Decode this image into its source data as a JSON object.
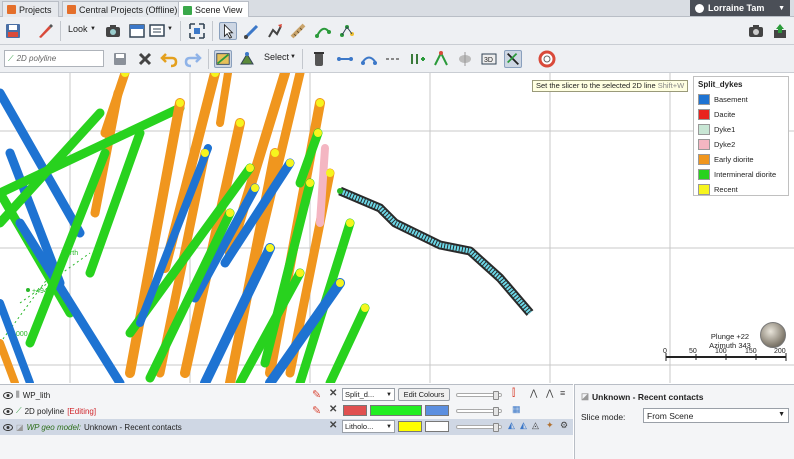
{
  "tabs": [
    {
      "label": "Projects",
      "icon": "projects-icon"
    },
    {
      "label": "Central Projects (Offline)",
      "icon": "central-projects-icon"
    },
    {
      "label": "Scene View",
      "icon": "scene-view-icon",
      "active": true
    }
  ],
  "user": {
    "name": "Lorraine Tam"
  },
  "toolbar": {
    "look_label": "Look",
    "select_label": "Select",
    "threed_label": "3D"
  },
  "object_field": {
    "placeholder": "2D polyline"
  },
  "tooltip": {
    "text": "Set the slicer to the selected 2D line",
    "shortcut": "Shift+W"
  },
  "legend": {
    "title": "Split_dykes",
    "items": [
      {
        "label": "Basement",
        "color": "#1e73d2"
      },
      {
        "label": "Dacite",
        "color": "#e8231e"
      },
      {
        "label": "Dyke1",
        "color": "#c8e6d4"
      },
      {
        "label": "Dyke2",
        "color": "#f4b6c2"
      },
      {
        "label": "Early diorite",
        "color": "#f0961e"
      },
      {
        "label": "Intermineral diorite",
        "color": "#28d21e"
      },
      {
        "label": "Recent",
        "color": "#f6f51e"
      }
    ]
  },
  "scene": {
    "grid_labels": [
      "North",
      "+494",
      "000"
    ],
    "view": {
      "plunge": "Plunge +22",
      "azimuth": "Azimuth 343"
    },
    "scale": {
      "ticks": [
        "0",
        "50",
        "100",
        "150",
        "200"
      ]
    }
  },
  "scene_list": {
    "rows": [
      {
        "name": "WP_lith",
        "dropdown": "Split_d...",
        "button": "Edit Colours"
      },
      {
        "name": "2D polyline",
        "status": "[Editing]",
        "colors": [
          "#e05050",
          "#22ee22",
          "#5c8fe0"
        ]
      },
      {
        "name_italic": "WP geo model:",
        "name": "Unknown - Recent contacts",
        "dropdown": "Litholo...",
        "colors": [
          "#ffff00",
          "#ffffff"
        ]
      }
    ]
  },
  "properties": {
    "title": "Unknown - Recent contacts",
    "slice_mode_label": "Slice mode:",
    "slice_mode_value": "From Scene"
  }
}
